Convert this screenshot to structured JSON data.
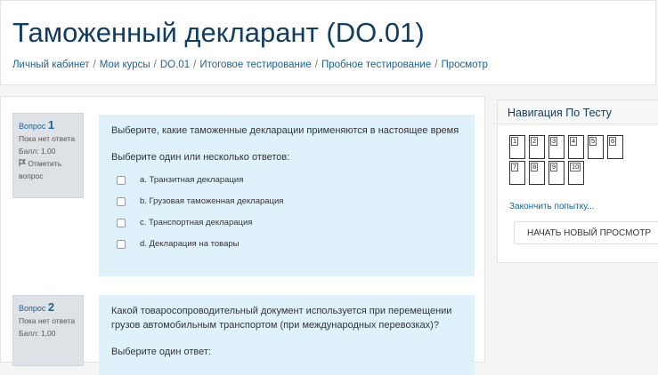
{
  "header": {
    "title": "Таможенный декларант (DO.01)",
    "breadcrumb": [
      "Личный кабинет",
      "Мои курсы",
      "DO.01",
      "Итоговое тестирование",
      "Пробное тестирование",
      "Просмотр"
    ]
  },
  "questions": [
    {
      "label": "Вопрос",
      "number": "1",
      "status": "Пока нет ответа",
      "grade": "Балл: 1,00",
      "flag": "Отметить вопрос",
      "text": "Выберите, какие таможенные декларации применяются в настоящее время",
      "prompt": "Выберите один или несколько ответов:",
      "answers": [
        "a. Транзитная декларация",
        "b. Грузовая таможенная декларация",
        "c. Транспортная декларация",
        "d. Декларация на товары"
      ]
    },
    {
      "label": "Вопрос",
      "number": "2",
      "status": "Пока нет ответа",
      "grade": "Балл: 1,00",
      "text": "Какой товаросопроводительный документ используется при перемещении грузов автомобильным транспортом (при международных перевозках)?",
      "prompt": "Выберите один ответ:"
    }
  ],
  "nav": {
    "title": "Навигация По Тесту",
    "buttons": [
      "1",
      "2",
      "3",
      "4",
      "5",
      "6",
      "7",
      "8",
      "9",
      "10"
    ],
    "finish": "Закончить попытку...",
    "new_preview": "НАЧАТЬ НОВЫЙ ПРОСМОТР"
  }
}
